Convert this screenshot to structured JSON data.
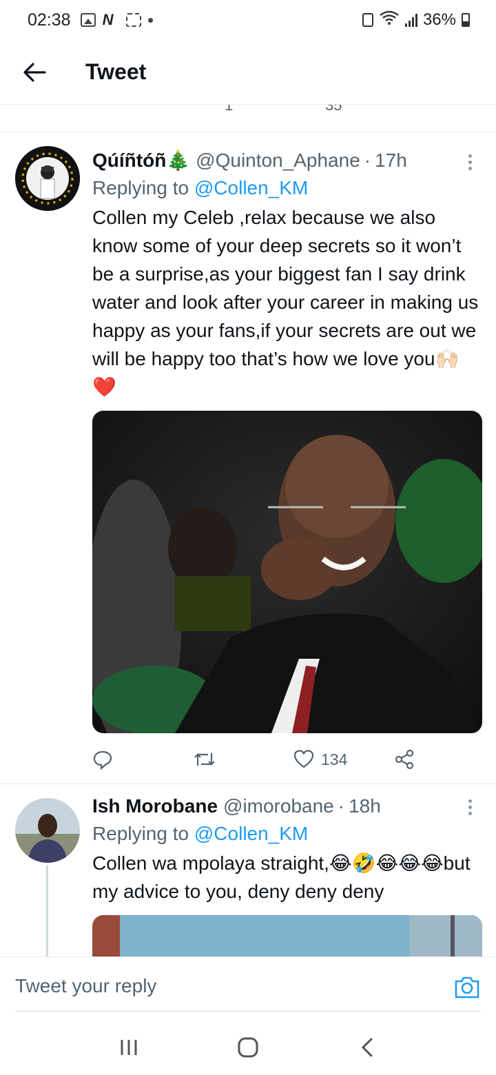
{
  "status_bar": {
    "time": "02:38",
    "battery": "36%"
  },
  "header": {
    "title": "Tweet"
  },
  "partial_actions": {
    "retweets": "1",
    "likes": "35"
  },
  "tweets": [
    {
      "name": "Qúíñtóñ🎄",
      "handle": "@Quinton_Aphane",
      "separator": "·",
      "time": "17h",
      "replying_prefix": "Replying to",
      "replying_to": "@Collen_KM",
      "text": "Collen my Celeb ,relax because we also know some of your deep secrets so it won’t be a surprise,as your biggest fan I say drink water and look after your career in making us happy as your fans,if your secrets are out we will be happy too that’s how we love you🙌🏻❤️",
      "likes": "134"
    },
    {
      "name": "Ish Morobane",
      "handle": "@imorobane",
      "separator": "·",
      "time": "18h",
      "replying_prefix": "Replying to",
      "replying_to": "@Collen_KM",
      "text": "Collen wa mpolaya straight,😂🤣😂😂😂but my advice to you, deny deny deny"
    }
  ],
  "composer": {
    "placeholder": "Tweet your reply"
  },
  "colors": {
    "accent": "#1d9bf0",
    "secondary_text": "#536471",
    "like_red": "#e0245e"
  }
}
